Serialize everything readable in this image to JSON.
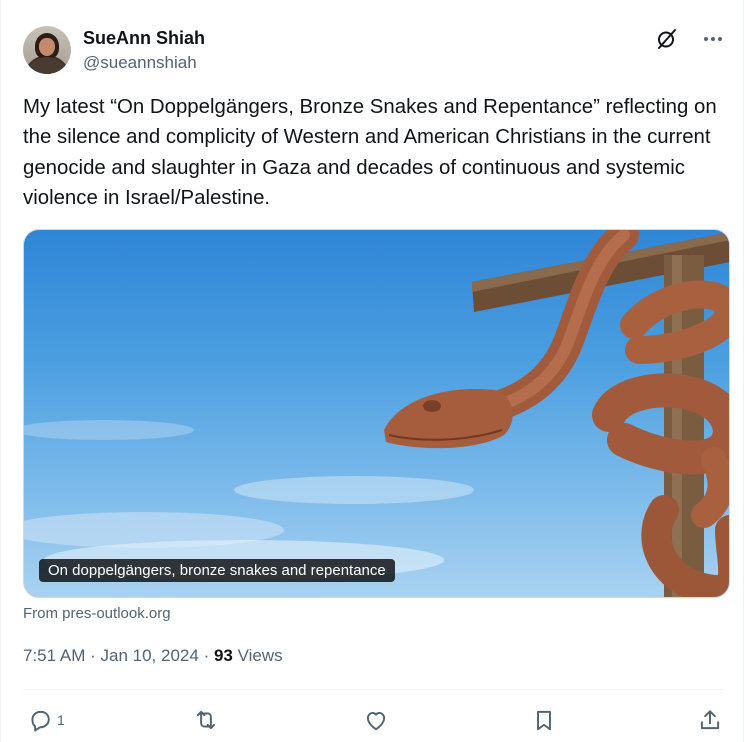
{
  "author": {
    "name": "SueAnn Shiah",
    "handle": "@sueannshiah"
  },
  "tweet": {
    "text": "My latest “On Doppelgängers, Bronze Snakes and Repentance” reflecting on the silence and complicity of Western and American Christians in the current genocide and slaughter in Gaza and decades of continuous and systemic violence in Israel/Palestine."
  },
  "media": {
    "caption": "On doppelgängers, bronze snakes and repentance"
  },
  "link_source": "From pres-outlook.org",
  "meta": {
    "time": "7:51 AM",
    "separator": "·",
    "date": "Jan 10, 2024",
    "views_count": "93",
    "views_label": "Views"
  },
  "actions": {
    "reply_count": "1",
    "retweet_count": "",
    "like_count": "",
    "bookmark_count": ""
  },
  "colors": {
    "text_primary": "#0f1419",
    "text_secondary": "#536471",
    "border": "#cfd9de"
  },
  "icons": [
    "grok-icon",
    "more-icon",
    "reply-icon",
    "retweet-icon",
    "like-icon",
    "bookmark-icon",
    "share-icon"
  ]
}
